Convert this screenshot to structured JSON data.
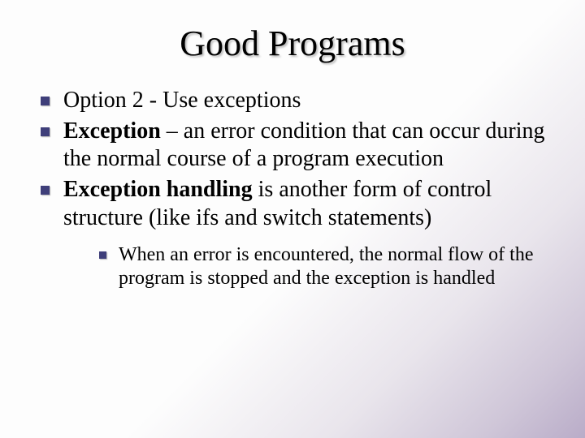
{
  "title": "Good Programs",
  "bullets": [
    {
      "parts": [
        {
          "text": "Option 2 - Use exceptions",
          "bold": false
        }
      ]
    },
    {
      "parts": [
        {
          "text": "Exception",
          "bold": true
        },
        {
          "text": " – an error condition that can occur during the normal course of a program execution",
          "bold": false
        }
      ]
    },
    {
      "parts": [
        {
          "text": "Exception handling",
          "bold": true
        },
        {
          "text": " is another form of control structure (like ifs and switch statements)",
          "bold": false
        }
      ],
      "sub": [
        {
          "parts": [
            {
              "text": "When an error is encountered, the normal flow of the program is stopped and the exception is handled",
              "bold": false
            }
          ]
        }
      ]
    }
  ]
}
